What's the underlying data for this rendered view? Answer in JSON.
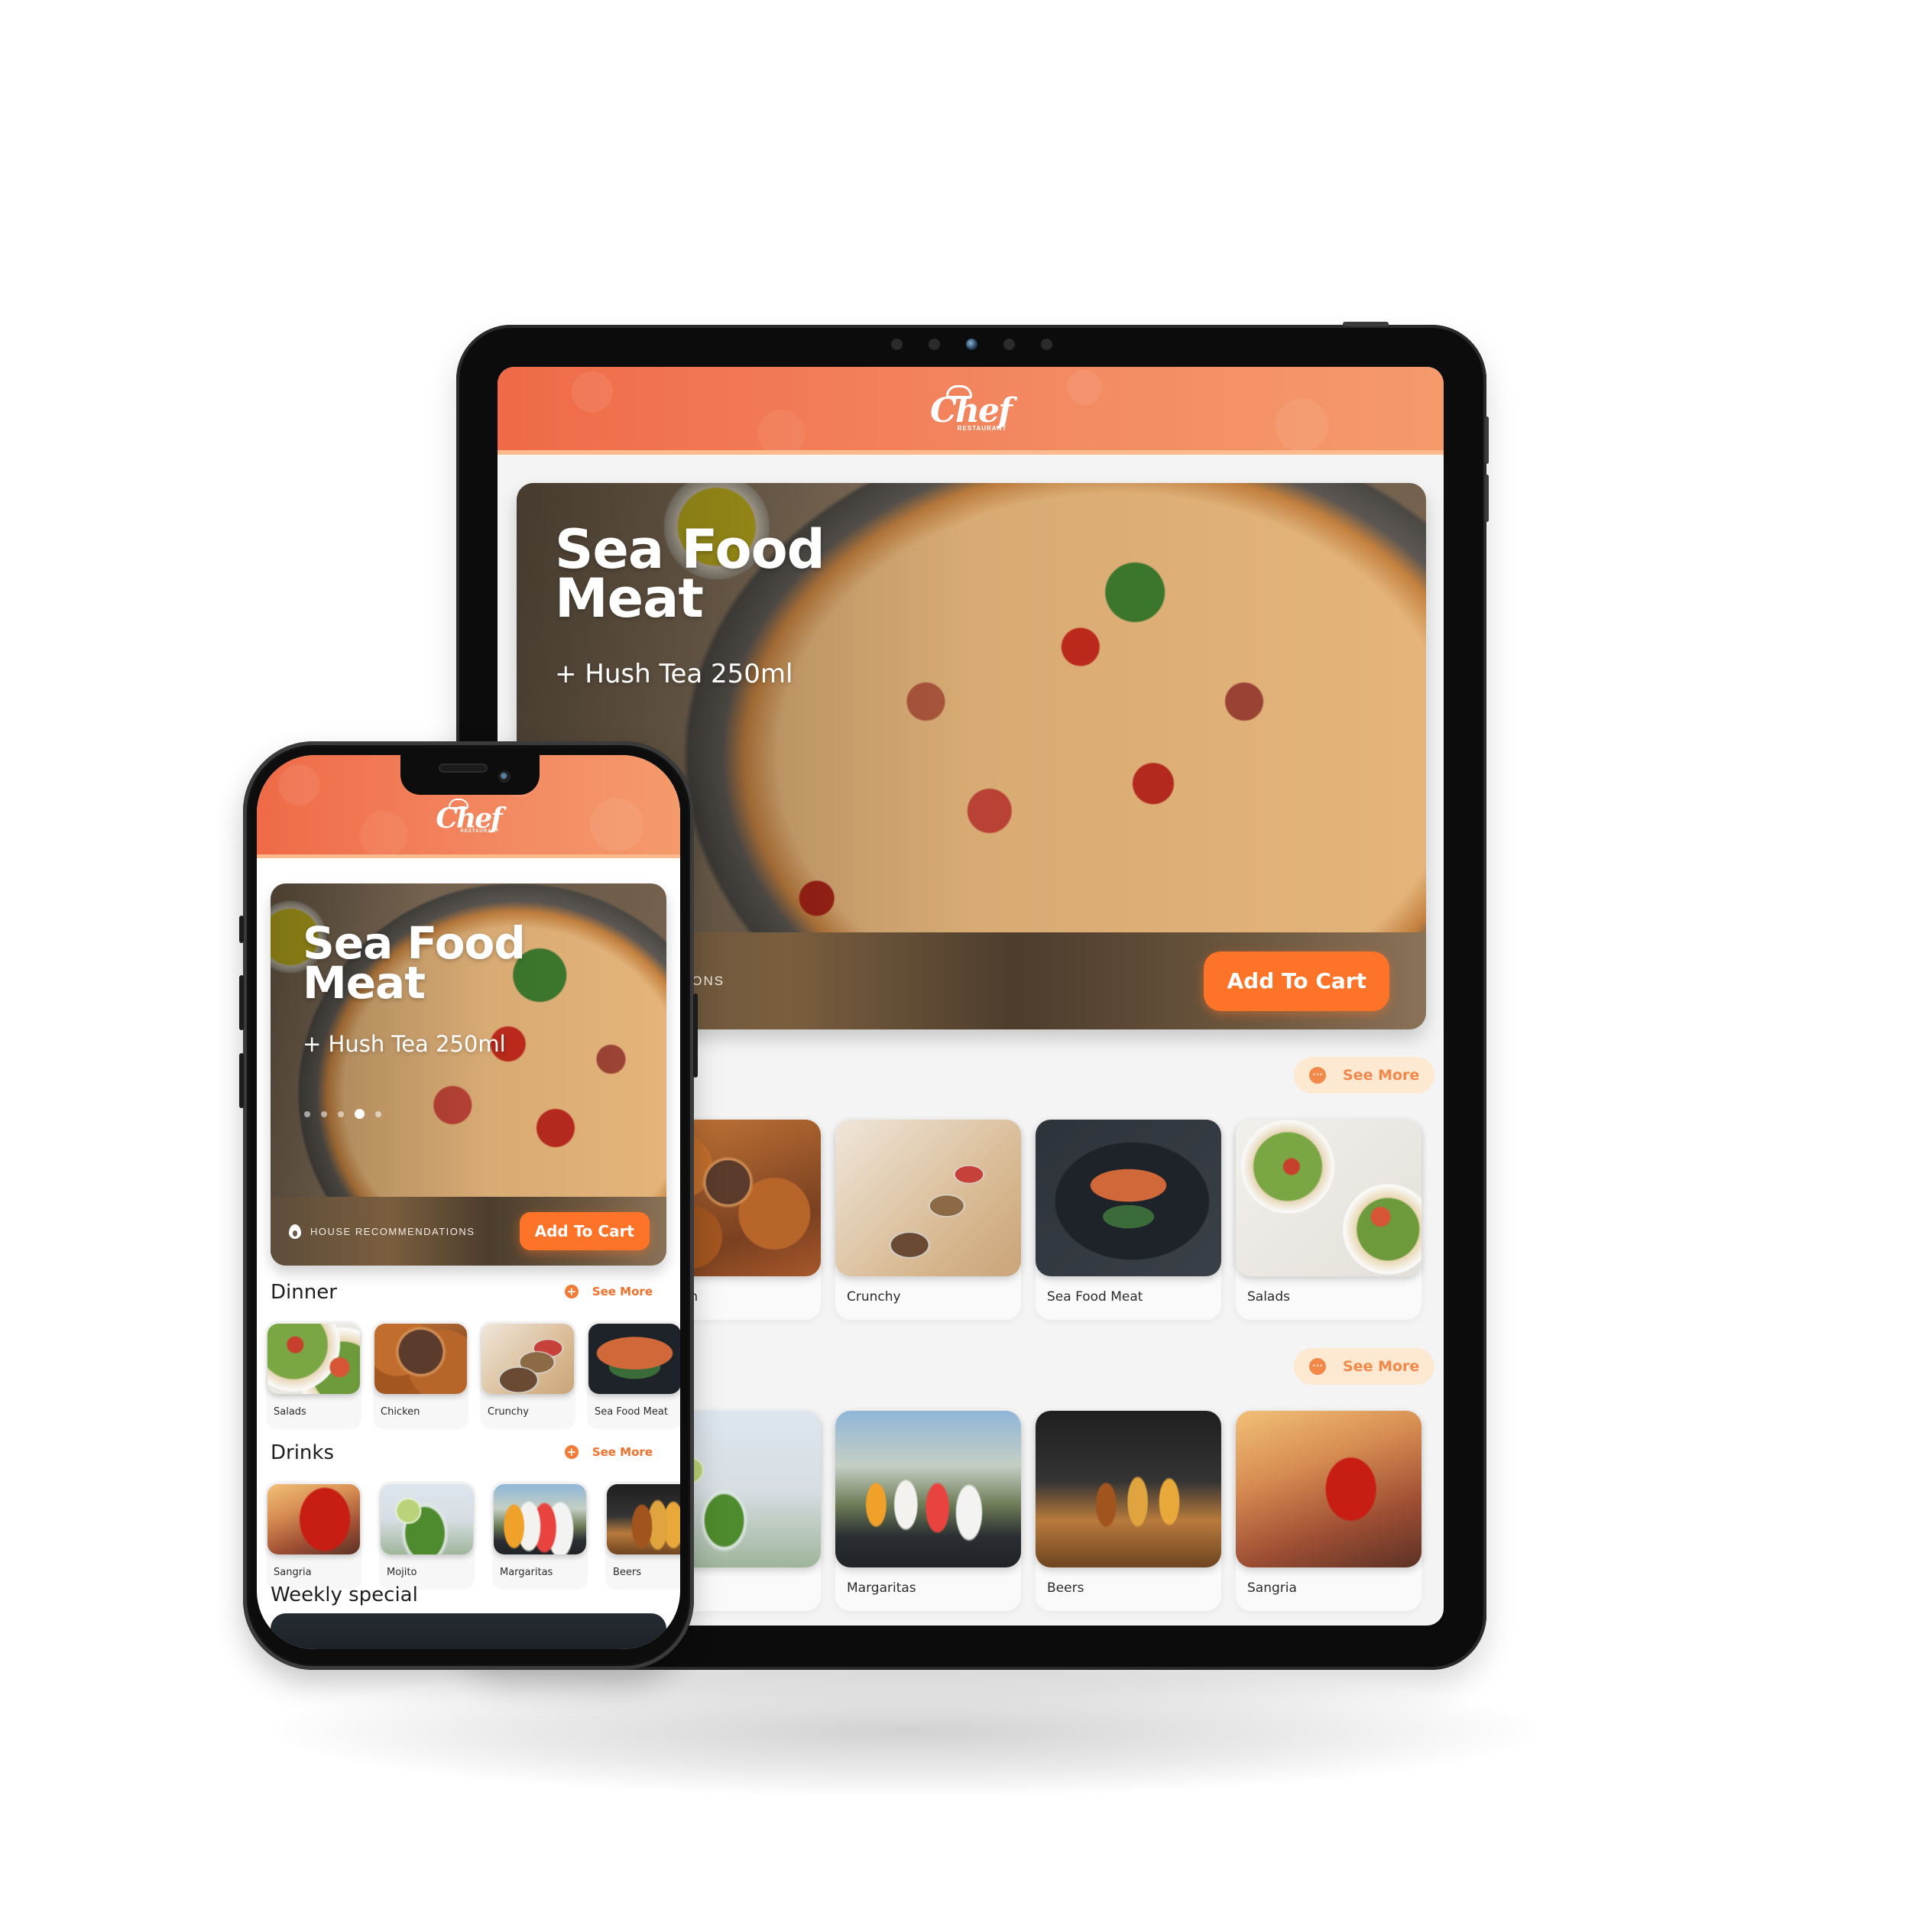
{
  "brand": {
    "logo_text": "Chef",
    "logo_subtext": "RESTAURANT",
    "primary_color": "#ef6a47",
    "accent_color": "#fd7328",
    "see_more_bg": "#fde8d2"
  },
  "hero": {
    "title_line1": "Sea Food",
    "title_line2": "Meat",
    "subtitle": "+ Hush Tea 250ml",
    "badge_label": "HOUSE RECOMMENDATIONS",
    "badge_label_tablet_visible": "MENDATIONS",
    "cta_label": "Add To Cart",
    "carousel": {
      "count": 5,
      "active_index": 3
    }
  },
  "tablet": {
    "sections": [
      {
        "see_more_label": "See More",
        "items": [
          {
            "label": "Chicken",
            "image": "chicken"
          },
          {
            "label": "Crunchy",
            "image": "crunchy"
          },
          {
            "label": "Sea Food Meat",
            "image": "seafood"
          },
          {
            "label": "Salads",
            "image": "salads"
          }
        ]
      },
      {
        "see_more_label": "See More",
        "items": [
          {
            "label": "Mojito",
            "image": "mojito"
          },
          {
            "label": "Margaritas",
            "image": "margaritas"
          },
          {
            "label": "Beers",
            "image": "beers"
          },
          {
            "label": "Sangria",
            "image": "sangria"
          }
        ]
      }
    ]
  },
  "phone": {
    "sections": [
      {
        "title": "Dinner",
        "see_more_label": "See More",
        "items": [
          {
            "label": "Salads",
            "image": "salads"
          },
          {
            "label": "Chicken",
            "image": "chicken"
          },
          {
            "label": "Crunchy",
            "image": "crunchy"
          },
          {
            "label": "Sea Food Meat",
            "image": "seafood"
          }
        ]
      },
      {
        "title": "Drinks",
        "see_more_label": "See More",
        "items": [
          {
            "label": "Sangria",
            "image": "sangria"
          },
          {
            "label": "Mojito",
            "image": "mojito"
          },
          {
            "label": "Margaritas",
            "image": "margaritas"
          },
          {
            "label": "Beers",
            "image": "beers"
          }
        ]
      }
    ],
    "weekly_title": "Weekly special"
  },
  "icons": {
    "badge": "flame-icon",
    "see_more_tablet": "more-dots-icon",
    "see_more_phone": "plus-circle-icon"
  }
}
